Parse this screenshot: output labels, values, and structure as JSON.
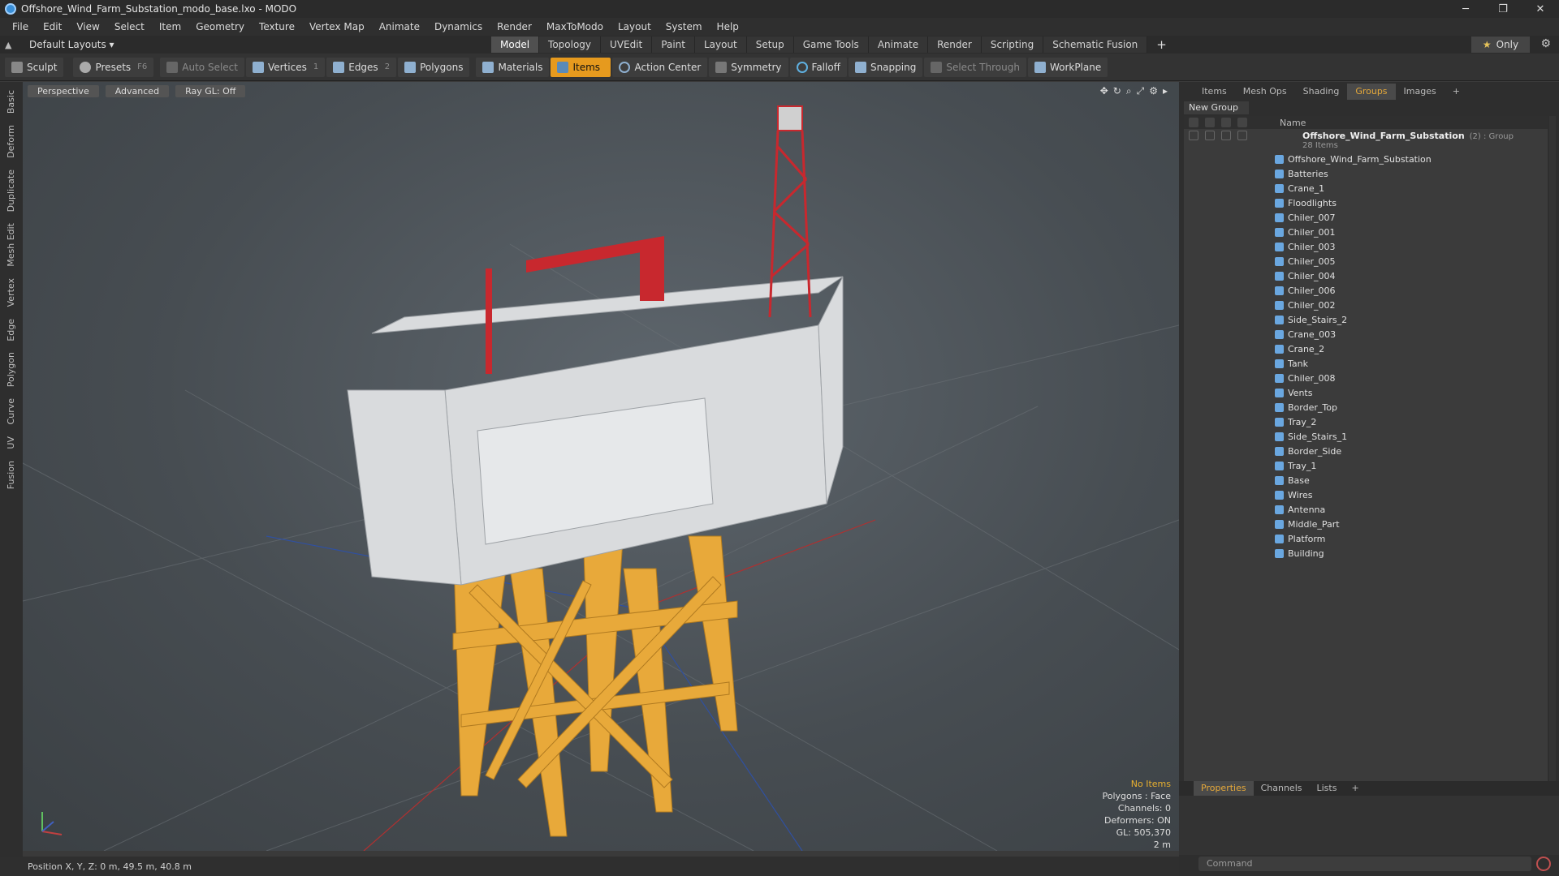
{
  "window": {
    "title": "Offshore_Wind_Farm_Substation_modo_base.lxo - MODO",
    "min": "─",
    "max": "❐",
    "close": "✕"
  },
  "menu": [
    "File",
    "Edit",
    "View",
    "Select",
    "Item",
    "Geometry",
    "Texture",
    "Vertex Map",
    "Animate",
    "Dynamics",
    "Render",
    "MaxToModo",
    "Layout",
    "System",
    "Help"
  ],
  "layout": {
    "selector": "Default Layouts ▾",
    "tabs": [
      "Model",
      "Topology",
      "UVEdit",
      "Paint",
      "Layout",
      "Setup",
      "Game Tools",
      "Animate",
      "Render",
      "Scripting",
      "Schematic Fusion"
    ],
    "active_tab": "Model",
    "only_label": "Only",
    "only_star": "★"
  },
  "toolbar": {
    "sculpt": "Sculpt",
    "presets": "Presets",
    "presets_key": "F6",
    "auto_select": "Auto Select",
    "vertices": "Vertices",
    "vertices_count": "1",
    "edges": "Edges",
    "edges_count": "2",
    "polygons": "Polygons",
    "materials": "Materials",
    "items": "Items",
    "action_center": "Action Center",
    "symmetry": "Symmetry",
    "falloff": "Falloff",
    "snapping": "Snapping",
    "select_through": "Select Through",
    "workplane": "WorkPlane"
  },
  "left_tabs": [
    "Basic",
    "Deform",
    "Duplicate",
    "Mesh Edit",
    "Vertex",
    "Edge",
    "Polygon",
    "Curve",
    "UV",
    "Fusion"
  ],
  "viewport": {
    "view": "Perspective",
    "shading": "Advanced",
    "raygl": "Ray GL: Off",
    "stats": {
      "selection": "No Items",
      "polygons": "Polygons : Face",
      "channels": "Channels: 0",
      "deformers": "Deformers: ON",
      "gl": "GL: 505,370",
      "scale": "2 m"
    }
  },
  "status": {
    "position": "Position X, Y, Z:  0 m, 49.5 m, 40.8 m"
  },
  "right_panel": {
    "tabs": [
      "Items",
      "Mesh Ops",
      "Shading",
      "Groups",
      "Images"
    ],
    "active_tab": "Groups",
    "new_group": "New Group",
    "name_col": "Name",
    "group": {
      "name": "Offshore_Wind_Farm_Substation",
      "count": "(2) : Group",
      "items": "28 Items"
    },
    "children": [
      "Offshore_Wind_Farm_Substation",
      "Batteries",
      "Crane_1",
      "Floodlights",
      "Chiler_007",
      "Chiler_001",
      "Chiler_003",
      "Chiler_005",
      "Chiler_004",
      "Chiler_006",
      "Chiler_002",
      "Side_Stairs_2",
      "Crane_003",
      "Crane_2",
      "Tank",
      "Chiler_008",
      "Vents",
      "Border_Top",
      "Tray_2",
      "Side_Stairs_1",
      "Border_Side",
      "Tray_1",
      "Base",
      "Wires",
      "Antenna",
      "Middle_Part",
      "Platform",
      "Building"
    ],
    "bottom_tabs": [
      "Properties",
      "Channels",
      "Lists"
    ],
    "active_bottom": "Properties",
    "command_placeholder": "Command"
  },
  "colors": {
    "accent": "#e69a1e",
    "jacket": "#e8a93a",
    "crane_red": "#c8282e"
  }
}
